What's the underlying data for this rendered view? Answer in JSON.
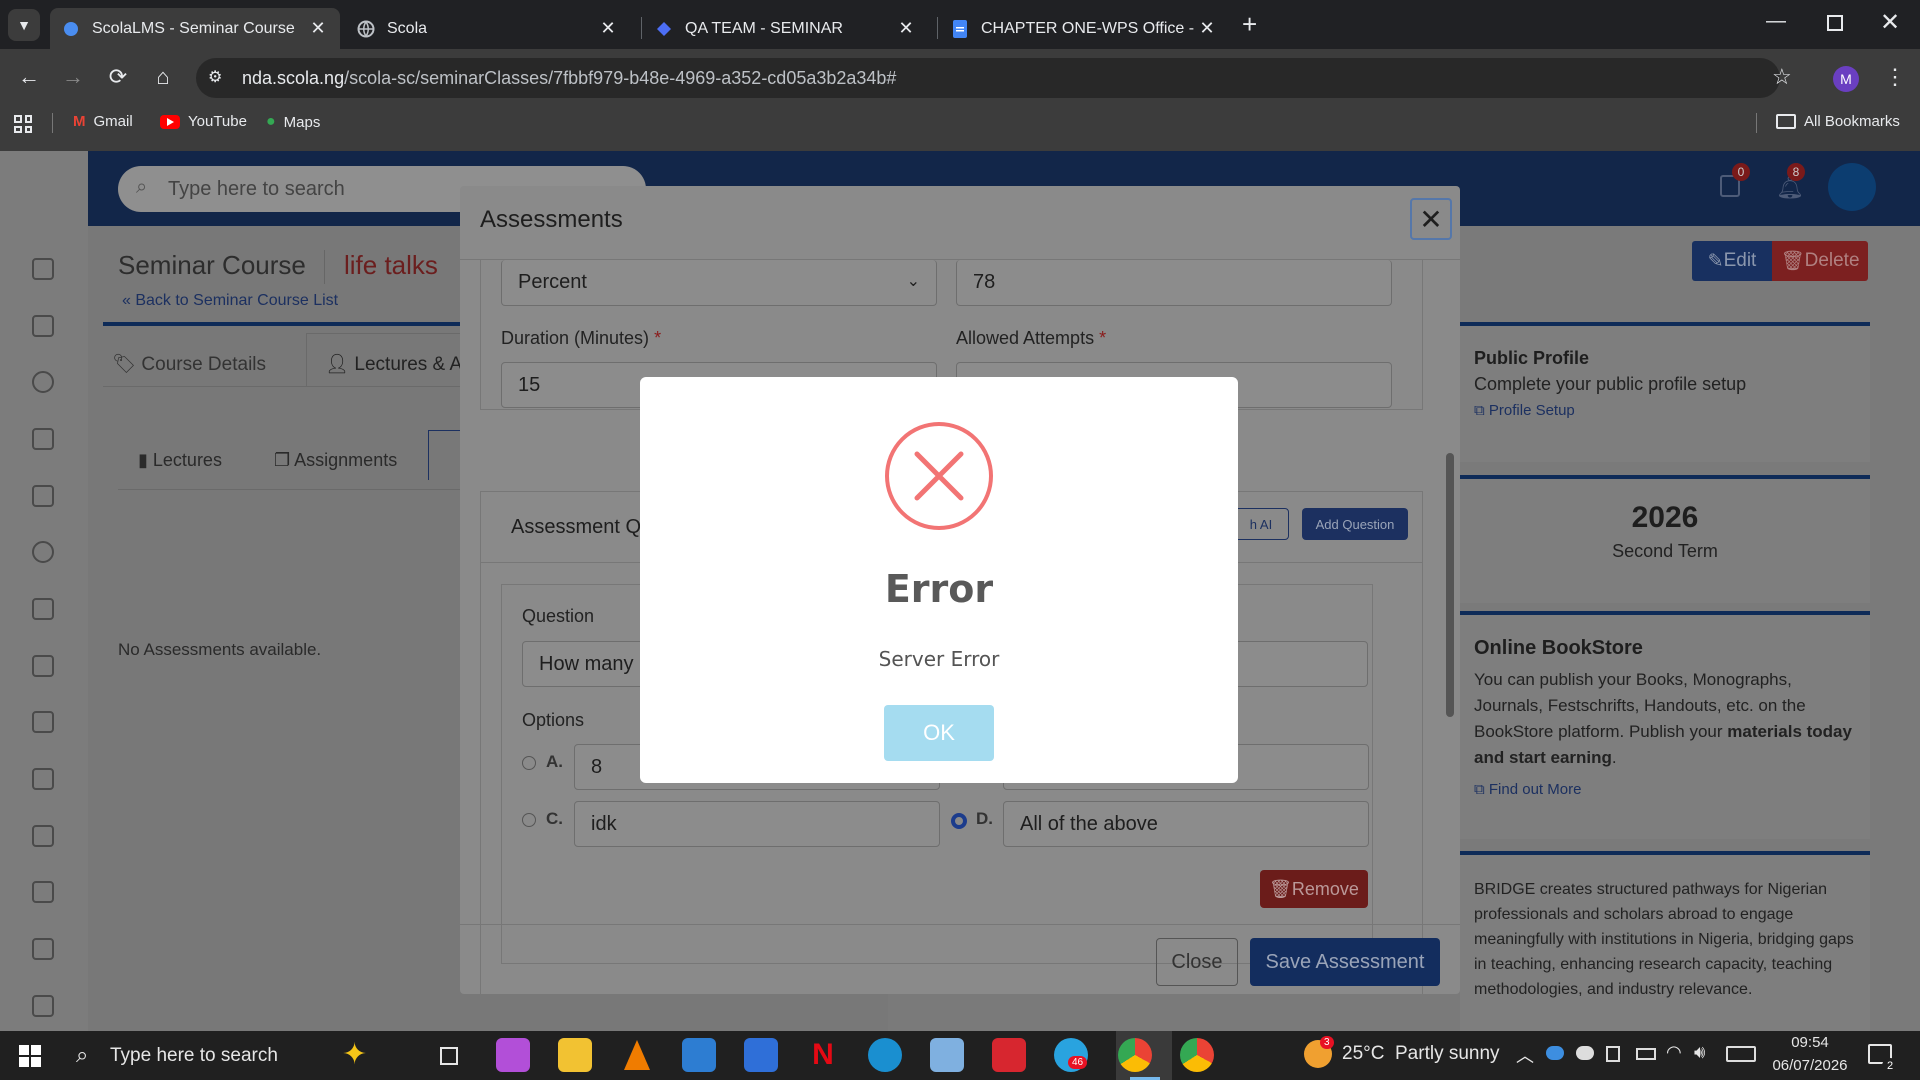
{
  "browser": {
    "tabs": [
      {
        "title": "ScolaLMS - Seminar Course",
        "active": true
      },
      {
        "title": "Scola",
        "active": false
      },
      {
        "title": "QA TEAM - SEMINAR",
        "active": false
      },
      {
        "title": "CHAPTER ONE-WPS Office - Go",
        "active": false
      }
    ],
    "new_tab_glyph": "+",
    "url_host": "nda.scola.ng",
    "url_path": "/scola-sc/seminarClasses/7fbbf979-b48e-4969-a352-cd05a3b2a34b#",
    "profile_initial": "M",
    "bookmarks": [
      "Gmail",
      "YouTube",
      "Maps"
    ],
    "all_bookmarks": "All Bookmarks"
  },
  "app": {
    "search_placeholder": "Type here to search",
    "task_badge": "0",
    "notification_badge": "8",
    "page_title": "Seminar Course",
    "page_subtitle": "life talks",
    "back_link": "« Back to Seminar Course List",
    "edit_label": "Edit",
    "delete_label": "Delete",
    "tabs": [
      "Course Details",
      "Lectures & As"
    ],
    "subtabs": [
      "Lectures",
      "Assignments"
    ],
    "empty_message": "No Assessments available.",
    "right": {
      "profile_title": "Public Profile",
      "profile_text": "Complete your public profile setup",
      "profile_link": "Profile Setup",
      "year": "2026",
      "term": "Second Term",
      "bookstore_title": "Online BookStore",
      "bookstore_text": "You can publish your Books, Monographs, Journals, Festschrifts, Handouts, etc. on the BookStore platform. Publish your",
      "bookstore_bold": "materials today and start earning",
      "bookstore_end": ".",
      "bookstore_link": "Find out More",
      "bridge_text": "BRIDGE creates structured pathways for Nigerian professionals and scholars abroad to engage meaningfully with institutions in Nigeria, bridging gaps in teaching, enhancing research capacity, teaching methodologies, and industry relevance."
    }
  },
  "assessment_modal": {
    "title": "Assessments",
    "score_type": "Percent",
    "score_value": "78",
    "duration_label": "Duration (Minutes)",
    "duration_value": "15",
    "attempts_label": "Allowed Attempts",
    "required_mark": "*",
    "questions_heading": "Assessment Q",
    "ai_button": "h AI",
    "add_question": "Add Question",
    "question_label": "Question",
    "question_value": "How many",
    "options_label": "Options",
    "options": [
      {
        "letter": "A.",
        "value": "8",
        "selected": false
      },
      {
        "letter": "C.",
        "value": "idk",
        "selected": false
      },
      {
        "letter": "D.",
        "value": "All of the above",
        "selected": true
      }
    ],
    "remove_label": "Remove",
    "close_label": "Close",
    "save_label": "Save Assessment"
  },
  "error_dialog": {
    "title": "Error",
    "message": "Server Error",
    "ok_label": "OK"
  },
  "taskbar": {
    "search_placeholder": "Type here to search",
    "weather": "25°C  Partly sunny",
    "time": "09:54",
    "date": "06/07/2026",
    "notification_count": "2",
    "telegram_badge": "46",
    "weather_badge": "3"
  },
  "colors": {
    "error_red": "#f27474",
    "ok_button": "#a5dcf0",
    "app_header": "#122649",
    "save_button": "#1a3a7a",
    "remove_button": "#c8302c"
  }
}
